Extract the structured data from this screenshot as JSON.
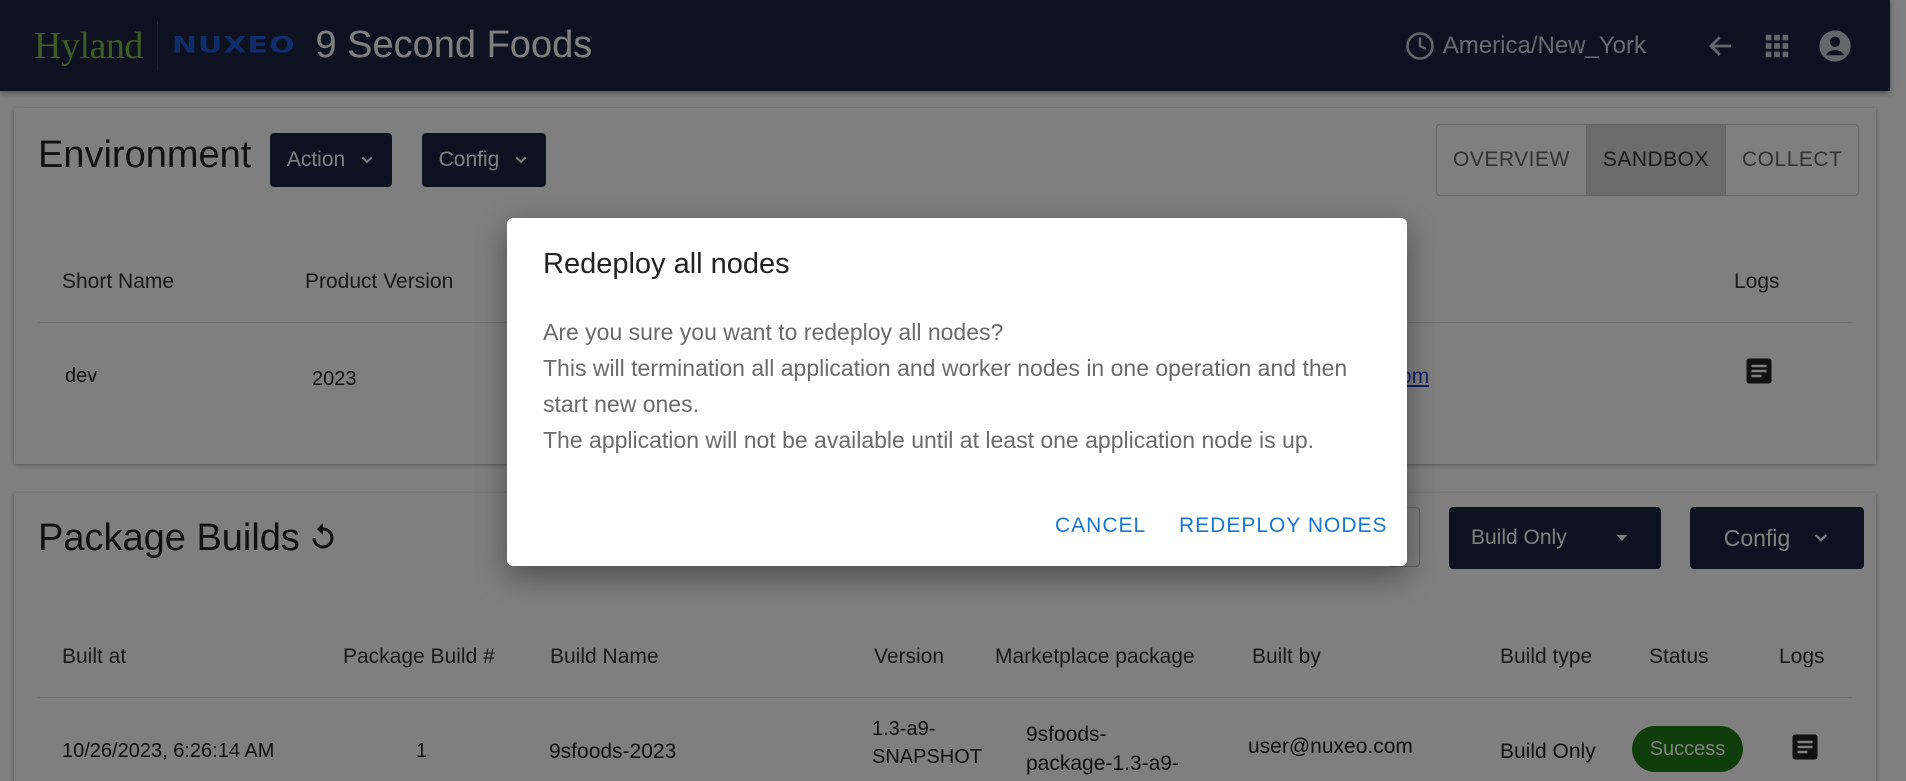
{
  "header": {
    "logo_hyland": "Hyland",
    "logo_nuxeo": "NUXEO",
    "title": "9 Second Foods",
    "timezone": "America/New_York"
  },
  "environment": {
    "title": "Environment",
    "action_label": "Action",
    "config_label": "Config",
    "tabs": [
      "OVERVIEW",
      "SANDBOX",
      "COLLECT"
    ],
    "active_tab": "SANDBOX",
    "columns": {
      "short_name": "Short Name",
      "product_version": "Product Version",
      "logs": "Logs"
    },
    "row": {
      "short_name": "dev",
      "product_version": "2023",
      "url_fragment": "d.com"
    }
  },
  "package_builds": {
    "title": "Package Builds",
    "build_only_label": "Build Only",
    "config_label": "Config",
    "columns": [
      "Built at",
      "Package Build #",
      "Build Name",
      "Version",
      "Marketplace package",
      "Built by",
      "Build type",
      "Status",
      "Logs"
    ],
    "row": {
      "built_at": "10/26/2023, 6:26:14 AM",
      "build_number": "1",
      "build_name": "9sfoods-2023",
      "version_line1": "1.3-a9-",
      "version_line2": "SNAPSHOT",
      "package_line1": "9sfoods-",
      "package_line2": "package-1.3-a9-",
      "built_by": "user@nuxeo.com",
      "build_type": "Build Only",
      "status": "Success"
    }
  },
  "dialog": {
    "title": "Redeploy all nodes",
    "line1": "Are you sure you want to redeploy all nodes?",
    "line2": "This will termination all application and worker nodes in one operation and then start new ones.",
    "line3": "The application will not be available until at least one application node is up.",
    "cancel_label": "CANCEL",
    "confirm_label": "REDEPLOY NODES"
  },
  "colors": {
    "navbar": "#1c2541",
    "accent": "#1976d2",
    "success": "#1f7a12"
  }
}
